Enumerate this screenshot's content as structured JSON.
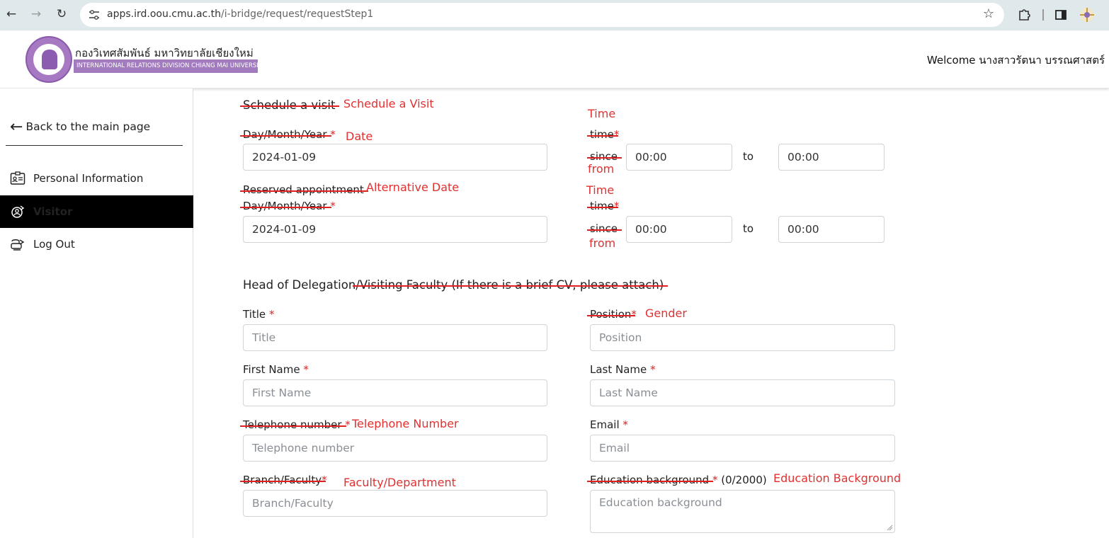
{
  "browser": {
    "url_host": "apps.ird.oou.cmu.ac.th",
    "url_path": "/i-bridge/request/requestStep1"
  },
  "header": {
    "org_thai": "กองวิเทศสัมพันธ์ มหาวิทยาลัยเชียงใหม่",
    "org_english": "INTERNATIONAL RELATIONS DIVISION CHIANG MAI UNIVERSITY",
    "welcome": "Welcome นางสาวรัตนา บรรณศาสตร์"
  },
  "sidebar": {
    "back_label": "Back to the main page",
    "items": [
      {
        "label": "Personal Information",
        "icon": "id-card-icon"
      },
      {
        "label": "Visitor",
        "icon": "visitor-icon"
      },
      {
        "label": "Log Out",
        "icon": "logout-icon"
      }
    ]
  },
  "form": {
    "schedule": {
      "title": "Schedule a visit",
      "title_anno": "Schedule a Visit",
      "date_label": "Day/Month/Year",
      "date_anno": "Date",
      "date_value": "2024-01-09",
      "time_anno": "Time",
      "time_label": "time",
      "since_label": "since",
      "since_anno": "from",
      "time_from": "00:00",
      "to_label": "to",
      "time_to": "00:00"
    },
    "reserved": {
      "title": "Reserved appointment",
      "title_anno": "Alternative Date",
      "date_label": "Day/Month/Year",
      "date_value": "2024-01-09",
      "time_anno": "Time",
      "time_label": "time",
      "since_label": "since",
      "since_anno": "from",
      "time_from": "00:00",
      "to_label": "to",
      "time_to": "00:00"
    },
    "head": {
      "title_main": "Head of Delegation",
      "title_struck": "/Visiting Faculty (If there is a brief CV, please attach)",
      "title_label": "Title",
      "title_placeholder": "Title",
      "position_label": "Position",
      "position_anno": "Gender",
      "position_placeholder": "Position",
      "first_name_label": "First Name",
      "first_name_placeholder": "First Name",
      "last_name_label": "Last Name",
      "last_name_placeholder": "Last Name",
      "phone_label": "Telephone number",
      "phone_anno": "Telephone Number",
      "phone_placeholder": "Telephone number",
      "email_label": "Email",
      "email_placeholder": "Email",
      "branch_label": "Branch/Faculty",
      "branch_anno": "Faculty/Department",
      "branch_placeholder": "Branch/Faculty",
      "edu_label": "Education background",
      "edu_counter": "(0/2000)",
      "edu_anno": "Education Background",
      "edu_placeholder": "Education background"
    },
    "required_mark": "*"
  }
}
